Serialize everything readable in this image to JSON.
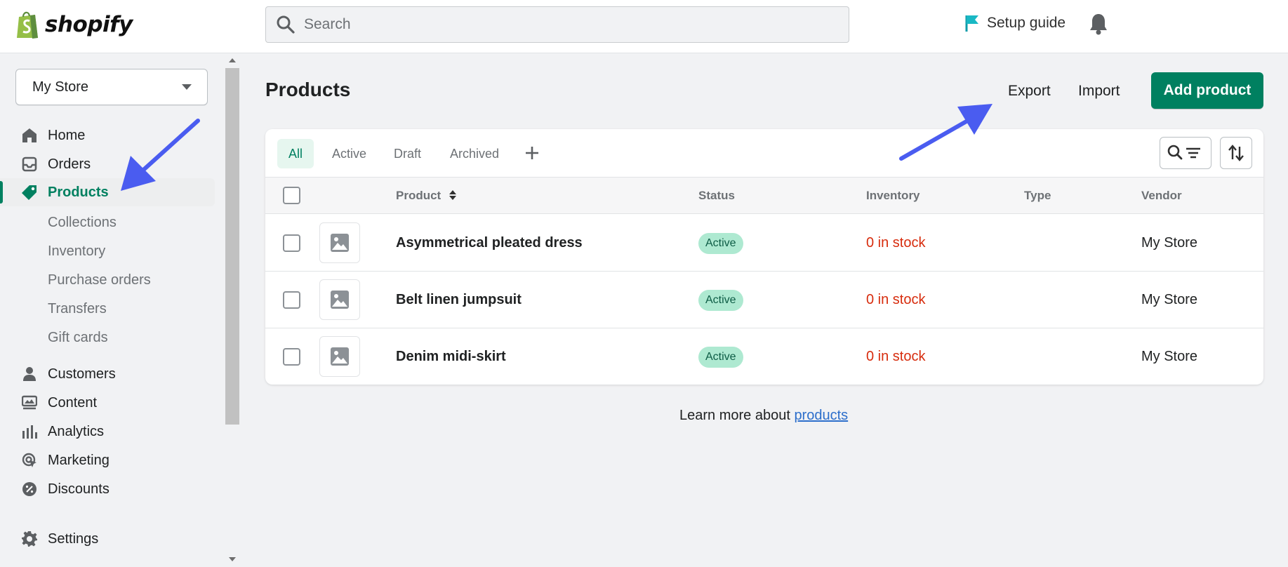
{
  "topbar": {
    "logo_text": "shopify",
    "search_placeholder": "Search",
    "setup_guide_label": "Setup guide"
  },
  "sidebar": {
    "store_name": "My Store",
    "nav": [
      {
        "label": "Home",
        "icon": "home-icon"
      },
      {
        "label": "Orders",
        "icon": "inbox-icon"
      },
      {
        "label": "Products",
        "icon": "tag-icon",
        "active": true
      },
      {
        "label": "Customers",
        "icon": "person-icon"
      },
      {
        "label": "Content",
        "icon": "content-icon"
      },
      {
        "label": "Analytics",
        "icon": "bar-chart-icon"
      },
      {
        "label": "Marketing",
        "icon": "target-icon"
      },
      {
        "label": "Discounts",
        "icon": "discount-icon"
      },
      {
        "label": "Settings",
        "icon": "gear-icon"
      }
    ],
    "product_subnav": [
      "Collections",
      "Inventory",
      "Purchase orders",
      "Transfers",
      "Gift cards"
    ]
  },
  "page": {
    "title": "Products",
    "export_label": "Export",
    "import_label": "Import",
    "add_product_label": "Add product"
  },
  "tabs": [
    "All",
    "Active",
    "Draft",
    "Archived"
  ],
  "table": {
    "columns": [
      "Product",
      "Status",
      "Inventory",
      "Type",
      "Vendor"
    ],
    "rows": [
      {
        "product": "Asymmetrical pleated dress",
        "status": "Active",
        "inventory": "0 in stock",
        "type": "",
        "vendor": "My Store"
      },
      {
        "product": "Belt linen jumpsuit",
        "status": "Active",
        "inventory": "0 in stock",
        "type": "",
        "vendor": "My Store"
      },
      {
        "product": "Denim midi-skirt",
        "status": "Active",
        "inventory": "0 in stock",
        "type": "",
        "vendor": "My Store"
      }
    ]
  },
  "footer": {
    "learn_prefix": "Learn more about ",
    "learn_link": "products"
  },
  "colors": {
    "brand_green": "#008060",
    "annotation_arrow": "#4a5cf0",
    "stock_red": "#d72c0d",
    "badge_green": "#aee9d1"
  }
}
